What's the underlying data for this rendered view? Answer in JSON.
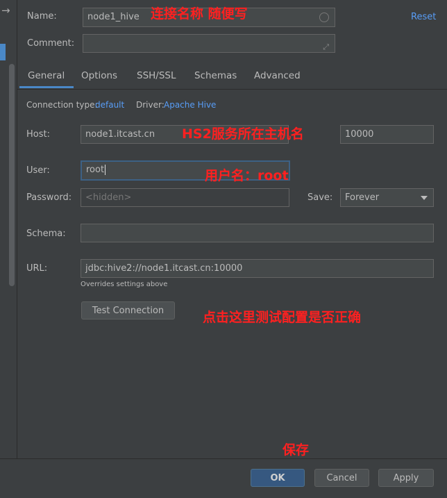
{
  "header": {
    "name_label": "Name:",
    "name_value": "node1_hive",
    "comment_label": "Comment:",
    "comment_value": "",
    "reset_label": "Reset"
  },
  "tabs": [
    {
      "label": "General"
    },
    {
      "label": "Options"
    },
    {
      "label": "SSH/SSL"
    },
    {
      "label": "Schemas"
    },
    {
      "label": "Advanced"
    }
  ],
  "general": {
    "conn_type_label": "Connection type:",
    "conn_type_value": "default",
    "driver_label": "Driver:",
    "driver_value": "Apache Hive",
    "host_label": "Host:",
    "host_value": "node1.itcast.cn",
    "port_value": "10000",
    "user_label": "User:",
    "user_value": "root",
    "password_label": "Password:",
    "password_placeholder": "<hidden>",
    "save_label": "Save:",
    "save_value": "Forever",
    "schema_label": "Schema:",
    "schema_value": "",
    "url_label": "URL:",
    "url_value": "jdbc:hive2://node1.itcast.cn:10000",
    "url_note": "Overrides settings above",
    "test_connection_label": "Test Connection"
  },
  "footer": {
    "ok_label": "OK",
    "cancel_label": "Cancel",
    "apply_label": "Apply"
  },
  "annotations": {
    "name_note": "连接名称 随便写",
    "host_note": "HS2服务所在主机名",
    "user_note": "用户名：root",
    "test_note": "点击这里测试配置是否正确",
    "save_note": "保存"
  },
  "colors": {
    "background": "#3c3f41",
    "accent": "#4a88c7",
    "link": "#589df6",
    "annotation": "#ff2020"
  }
}
